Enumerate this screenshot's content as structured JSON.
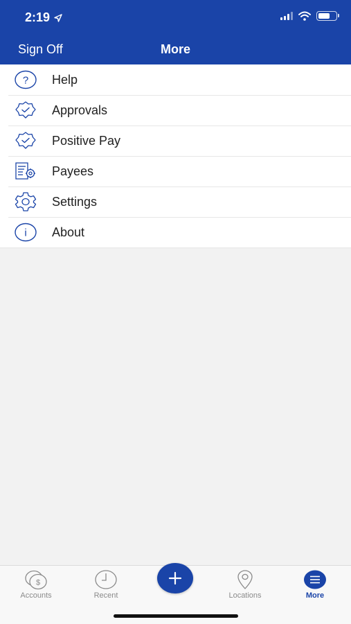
{
  "status_bar": {
    "time": "2:19",
    "battery_level": 0.7
  },
  "nav": {
    "left_label": "Sign Off",
    "title": "More"
  },
  "menu": {
    "items": [
      {
        "label": "Help",
        "icon": "help-icon"
      },
      {
        "label": "Approvals",
        "icon": "approval-badge-icon"
      },
      {
        "label": "Positive Pay",
        "icon": "positive-pay-badge-icon"
      },
      {
        "label": "Payees",
        "icon": "payees-icon"
      },
      {
        "label": "Settings",
        "icon": "gear-icon"
      },
      {
        "label": "About",
        "icon": "info-icon"
      }
    ]
  },
  "tabbar": {
    "tabs": [
      {
        "label": "Accounts",
        "icon": "accounts-coins-icon",
        "active": false
      },
      {
        "label": "Recent",
        "icon": "clock-icon",
        "active": false
      },
      {
        "label": "",
        "icon": "plus-icon",
        "active": false
      },
      {
        "label": "Locations",
        "icon": "location-pin-icon",
        "active": false
      },
      {
        "label": "More",
        "icon": "menu-icon",
        "active": true
      }
    ]
  },
  "colors": {
    "brand": "#1a44a8",
    "background": "#f2f2f2",
    "inactive": "#8a8a8a"
  }
}
